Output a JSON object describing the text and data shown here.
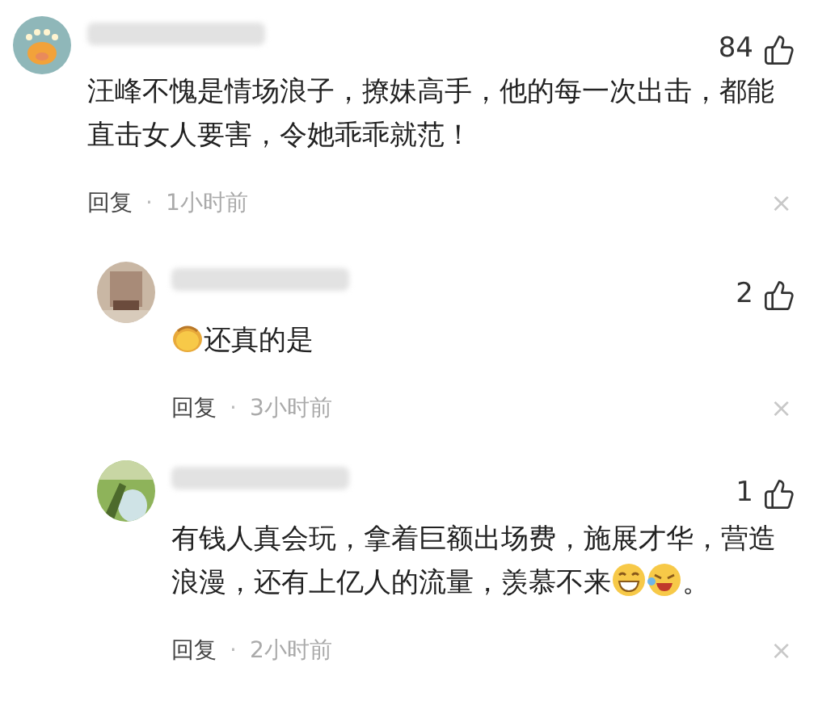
{
  "comments": [
    {
      "likes": "84",
      "segments": [
        {
          "kind": "text",
          "text": "汪峰不愧是情场浪子，撩妹高手，他的每一次出击，都能直击女人要害，令她乖乖就范！"
        }
      ],
      "reply_label": "回复",
      "separator": "·",
      "time": "1小时前",
      "close": "×",
      "replies": [
        {
          "likes": "2",
          "segments": [
            {
              "kind": "hands"
            },
            {
              "kind": "text",
              "text": "还真的是"
            }
          ],
          "reply_label": "回复",
          "separator": "·",
          "time": "3小时前",
          "close": "×"
        },
        {
          "likes": "1",
          "segments": [
            {
              "kind": "text",
              "text": "有钱人真会玩，拿着巨额出场费，施展才华，营造浪漫，还有上亿人的流量，羡慕不来"
            },
            {
              "kind": "grin"
            },
            {
              "kind": "laugh"
            },
            {
              "kind": "text",
              "text": "。"
            }
          ],
          "reply_label": "回复",
          "separator": "·",
          "time": "2小时前",
          "close": "×"
        }
      ]
    }
  ]
}
